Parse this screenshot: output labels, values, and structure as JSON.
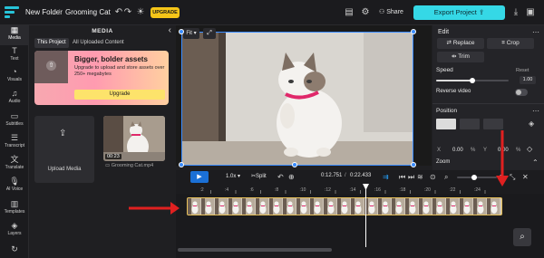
{
  "topbar": {
    "folder": "New Folder",
    "project": "Grooming Cat",
    "upgrade_label": "UPGRADE",
    "share_label": "Share",
    "export_label": "Export Project"
  },
  "nav": [
    {
      "label": "Media",
      "icon": "media-icon"
    },
    {
      "label": "Text",
      "icon": "text-icon"
    },
    {
      "label": "Visuals",
      "icon": "visuals-icon"
    },
    {
      "label": "Audio",
      "icon": "audio-icon"
    },
    {
      "label": "Subtitles",
      "icon": "subtitles-icon"
    },
    {
      "label": "Transcript",
      "icon": "transcript-icon"
    },
    {
      "label": "Translate",
      "icon": "translate-icon"
    },
    {
      "label": "AI Voice",
      "icon": "ai-voice-icon"
    },
    {
      "label": "Templates",
      "icon": "templates-icon"
    },
    {
      "label": "Layers",
      "icon": "layers-icon"
    }
  ],
  "media": {
    "title": "MEDIA",
    "tabs": [
      "This Project",
      "All Uploaded Content"
    ],
    "promo": {
      "title": "Bigger, bolder assets",
      "desc": "Upgrade to upload and store assets over 250+ megabytes",
      "button": "Upgrade"
    },
    "upload_label": "Upload Media",
    "clip": {
      "duration": "00:23",
      "name": "Grooming Cat.mp4"
    }
  },
  "stage": {
    "fit_label": "Fit"
  },
  "edit": {
    "title": "Edit",
    "replace": "Replace",
    "crop": "Crop",
    "trim": "Trim",
    "speed_label": "Speed",
    "speed_reset": "Reset",
    "speed_value": "1.00",
    "speed_fraction": 0.5,
    "reverse_label": "Reverse video",
    "position_label": "Position",
    "x_label": "X",
    "x_value": "0.00",
    "x_unit": "%",
    "y_label": "Y",
    "y_value": "0.00",
    "y_unit": "%",
    "zoom_label": "Zoom"
  },
  "timeline": {
    "speed": "1.0x",
    "split": "Split",
    "current_time": "0:12.751",
    "total_time": "0:22.433",
    "ticks": [
      "2",
      "4",
      "6",
      "8",
      "10",
      "12",
      "14",
      "16",
      "18",
      "20",
      "22",
      "24"
    ],
    "playhead_time": 12.751
  },
  "colors": {
    "accent": "#35d8e6",
    "play": "#1b70d6",
    "selection": "#3a8cff",
    "clip_border": "#e8c15a",
    "annotation": "#e02020",
    "upgrade": "#f5c518"
  }
}
